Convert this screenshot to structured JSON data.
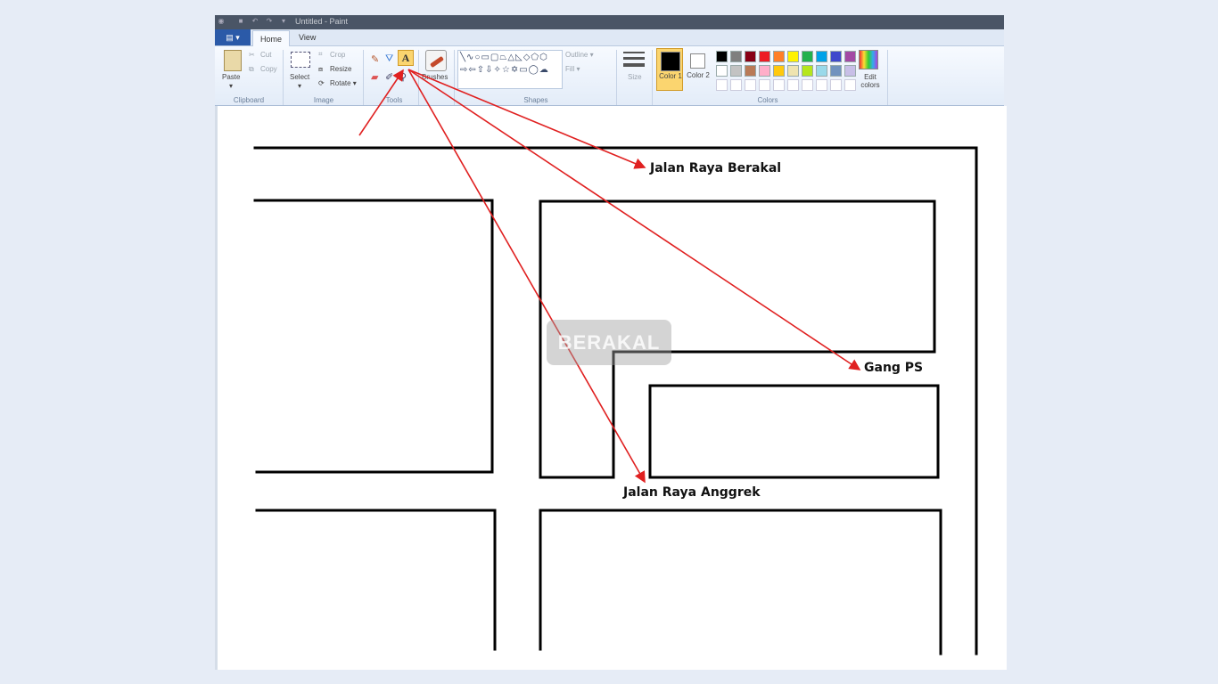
{
  "window": {
    "title": "Untitled - Paint"
  },
  "tabs": {
    "app_menu": "▤ ▾",
    "home": "Home",
    "view": "View"
  },
  "clipboard": {
    "paste": "Paste",
    "cut": "Cut",
    "copy": "Copy",
    "group": "Clipboard"
  },
  "image": {
    "select": "Select",
    "crop": "Crop",
    "resize": "Resize",
    "rotate": "Rotate ▾",
    "group": "Image"
  },
  "tools": {
    "group": "Tools",
    "text_glyph": "A"
  },
  "brushes": {
    "label": "Brushes"
  },
  "shapes": {
    "group": "Shapes",
    "outline": "Outline ▾",
    "fill": "Fill ▾",
    "glyphs": "╲∿○▭▢⏢△◺◇⬠⬡⇨⇦⇧⇩✧☆✡▭◯☁"
  },
  "size": {
    "label": "Size"
  },
  "colors": {
    "group": "Colors",
    "color1": "Color 1",
    "color2": "Color 2",
    "edit": "Edit colors",
    "palette_row1": [
      "#000000",
      "#7f7f7f",
      "#880015",
      "#ed1c24",
      "#ff7f27",
      "#fff200",
      "#22b14c",
      "#00a2e8",
      "#3f48cc",
      "#a349a4"
    ],
    "palette_row2": [
      "#ffffff",
      "#c3c3c3",
      "#b97a57",
      "#ffaec9",
      "#ffc90e",
      "#efe4b0",
      "#b5e61d",
      "#99d9ea",
      "#7092be",
      "#c8bfe7"
    ]
  },
  "watermark": "BERAKAL",
  "annotations": {
    "jalan_berakal": "Jalan Raya Berakal",
    "gang_ps": "Gang PS",
    "jalan_anggrek": "Jalan Raya Anggrek"
  },
  "accent_color": "#e02020"
}
